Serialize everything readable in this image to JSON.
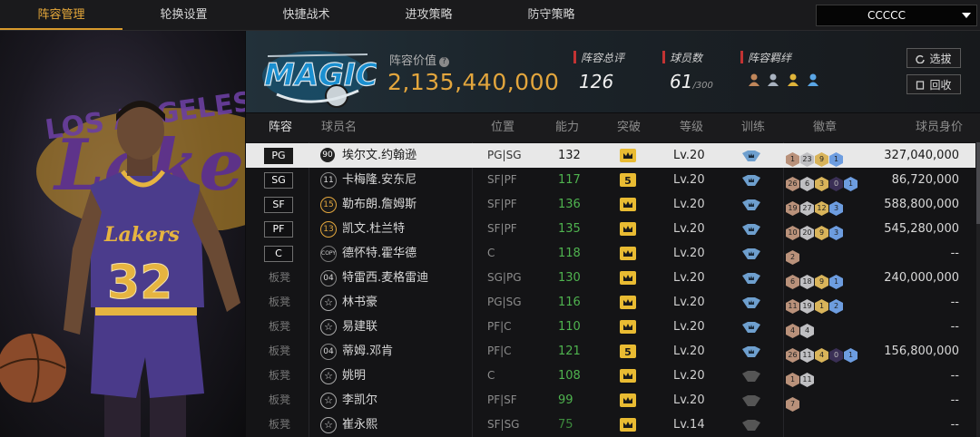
{
  "nav": {
    "tabs": [
      "阵容管理",
      "轮换设置",
      "快捷战术",
      "进攻策略",
      "防守策略"
    ],
    "active_index": 0,
    "team_select": "CCCCC"
  },
  "team": {
    "logo_text": "MAGIC",
    "value_label": "阵容价值",
    "value": "2,135,440,000",
    "stats": {
      "rating_label": "阵容总评",
      "rating": "126",
      "players_label": "球员数",
      "players": "61",
      "players_max": "/300",
      "bonds_label": "阵容羁绊"
    },
    "select_button": "选拔",
    "recycle_button": "回收"
  },
  "table": {
    "headers": {
      "pos": "阵容",
      "name": "球员名",
      "position": "位置",
      "ability": "能力",
      "breakthrough": "突破",
      "level": "等级",
      "training": "训练",
      "badge": "徽章",
      "salary": "球员身价"
    },
    "rows": [
      {
        "slot": "PG",
        "num": "90",
        "name": "埃尔文.约翰逊",
        "position": "PG|SG",
        "ability": "132",
        "crown": "",
        "level": "Lv.20",
        "badges": [
          [
            "b",
            "1"
          ],
          [
            "s",
            "23"
          ],
          [
            "g",
            "9"
          ],
          [
            "d",
            "1"
          ]
        ],
        "salary": "327,040,000"
      },
      {
        "slot": "SG",
        "num": "11",
        "name": "卡梅隆.安东尼",
        "position": "SF|PF",
        "ability": "117",
        "crown": "5",
        "level": "Lv.20",
        "badges": [
          [
            "b",
            "26"
          ],
          [
            "s",
            "6"
          ],
          [
            "g",
            "3"
          ],
          [
            "p",
            "0"
          ],
          [
            "d",
            "1"
          ]
        ],
        "salary": "86,720,000"
      },
      {
        "slot": "SF",
        "num": "15",
        "name": "勒布朗.詹姆斯",
        "position": "SF|PF",
        "ability": "136",
        "crown": "",
        "level": "Lv.20",
        "badges": [
          [
            "b",
            "19"
          ],
          [
            "s",
            "27"
          ],
          [
            "g",
            "12"
          ],
          [
            "d",
            "3"
          ]
        ],
        "salary": "588,800,000"
      },
      {
        "slot": "PF",
        "num": "13",
        "name": "凯文.杜兰特",
        "position": "SF|PF",
        "ability": "135",
        "crown": "",
        "level": "Lv.20",
        "badges": [
          [
            "b",
            "10"
          ],
          [
            "s",
            "20"
          ],
          [
            "g",
            "9"
          ],
          [
            "d",
            "3"
          ]
        ],
        "salary": "545,280,000"
      },
      {
        "slot": "C",
        "num": "COPY",
        "name": "德怀特.霍华德",
        "position": "C",
        "ability": "118",
        "crown": "",
        "level": "Lv.20",
        "badges": [
          [
            "b",
            "2"
          ]
        ],
        "salary": "--"
      },
      {
        "slot": "板凳",
        "num": "04",
        "name": "特雷西.麦格雷迪",
        "position": "SG|PG",
        "ability": "130",
        "crown": "",
        "level": "Lv.20",
        "badges": [
          [
            "b",
            "6"
          ],
          [
            "s",
            "18"
          ],
          [
            "g",
            "9"
          ],
          [
            "d",
            "1"
          ]
        ],
        "salary": "240,000,000"
      },
      {
        "slot": "板凳",
        "num": "☆",
        "name": "林书豪",
        "position": "PG|SG",
        "ability": "116",
        "crown": "",
        "level": "Lv.20",
        "badges": [
          [
            "b",
            "11"
          ],
          [
            "s",
            "19"
          ],
          [
            "g",
            "1"
          ],
          [
            "d",
            "2"
          ]
        ],
        "salary": "--"
      },
      {
        "slot": "板凳",
        "num": "☆",
        "name": "易建联",
        "position": "PF|C",
        "ability": "110",
        "crown": "",
        "level": "Lv.20",
        "badges": [
          [
            "b",
            "4"
          ],
          [
            "s",
            "4"
          ]
        ],
        "salary": "--"
      },
      {
        "slot": "板凳",
        "num": "04",
        "name": "蒂姆.邓肯",
        "position": "PF|C",
        "ability": "121",
        "crown": "5",
        "level": "Lv.20",
        "badges": [
          [
            "b",
            "26"
          ],
          [
            "s",
            "11"
          ],
          [
            "g",
            "4"
          ],
          [
            "p",
            "0"
          ],
          [
            "d",
            "1"
          ]
        ],
        "salary": "156,800,000"
      },
      {
        "slot": "板凳",
        "num": "☆",
        "name": "姚明",
        "position": "C",
        "ability": "108",
        "crown": "",
        "level": "Lv.20",
        "badges": [
          [
            "b",
            "1"
          ],
          [
            "s",
            "11"
          ]
        ],
        "salary": "--"
      },
      {
        "slot": "板凳",
        "num": "☆",
        "name": "李凯尔",
        "position": "PF|SF",
        "ability": "99",
        "crown": "",
        "level": "Lv.20",
        "badges": [
          [
            "b",
            "7"
          ]
        ],
        "salary": "--"
      },
      {
        "slot": "板凳",
        "num": "☆",
        "name": "崔永熙",
        "position": "SF|SG",
        "ability": "75",
        "crown": "",
        "level": "Lv.14",
        "badges": [],
        "salary": "--"
      }
    ]
  },
  "colors": {
    "accent": "#e3a63d",
    "ability_green": "#4fb34f",
    "selected_row": "#e8e8e8"
  }
}
